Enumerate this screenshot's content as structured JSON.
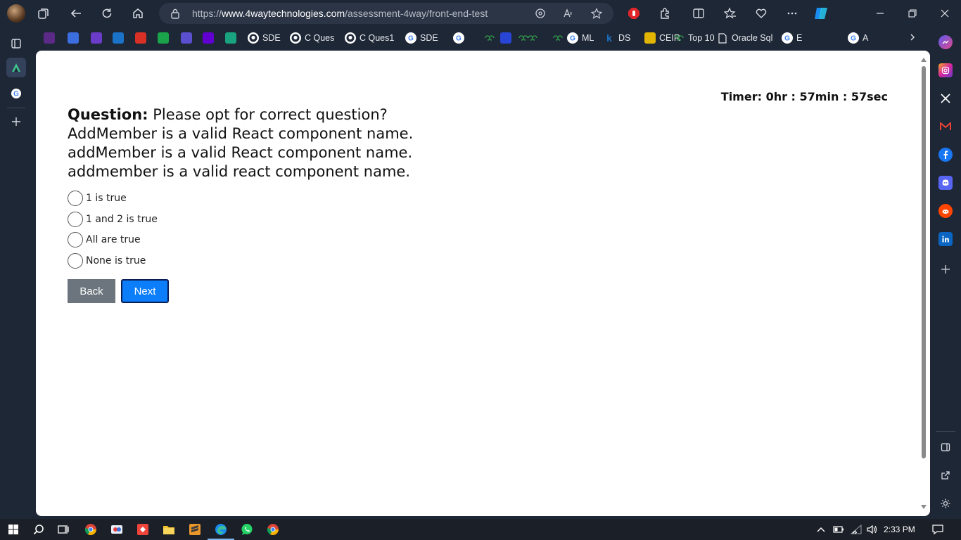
{
  "browser": {
    "url_prefix": "https://",
    "url_host": "www.4waytechnologies.com",
    "url_path": "/assessment-4way/front-end-test"
  },
  "bookmarks": [
    {
      "label": "",
      "icon": "purple-app-icon",
      "color": "#5b2a86"
    },
    {
      "label": "",
      "icon": "blue-flame-icon",
      "color": "#3b6fe0"
    },
    {
      "label": "",
      "icon": "to-icon",
      "color": "#6a3cc9"
    },
    {
      "label": "",
      "icon": "outlook-icon",
      "color": "#1a73c8"
    },
    {
      "label": "",
      "icon": "gmail-icon",
      "color": "#d93025"
    },
    {
      "label": "",
      "icon": "green-plus-icon",
      "color": "#1aa34a"
    },
    {
      "label": "",
      "icon": "swirl-icon",
      "color": "#5a4fcf"
    },
    {
      "label": "",
      "icon": "yahoo-icon",
      "color": "#6001d2"
    },
    {
      "label": "",
      "icon": "chatgpt-icon",
      "color": "#19a37f"
    },
    {
      "label": "SDE",
      "icon": "github-icon",
      "color": "#ffffff"
    },
    {
      "label": "C Ques",
      "icon": "github-icon",
      "color": "#ffffff"
    },
    {
      "label": "C Ques1",
      "icon": "github-icon",
      "color": "#ffffff"
    },
    {
      "label": "SDE",
      "icon": "google-icon",
      "color": "#ffffff"
    },
    {
      "label": "",
      "icon": "google-icon",
      "color": "#ffffff"
    },
    {
      "label": "",
      "icon": "gfg-icon",
      "color": "#2f8d46"
    },
    {
      "label": "",
      "icon": "blue-circle-icon",
      "color": "#2845d6"
    },
    {
      "label": "",
      "icon": "gfg-icon",
      "color": "#2f8d46"
    },
    {
      "label": "",
      "icon": "gfg-green-icon",
      "color": "#2f8d46"
    },
    {
      "label": "",
      "icon": "gfg-icon",
      "color": "#2f8d46"
    },
    {
      "label": "ML",
      "icon": "google-icon",
      "color": "#ffffff"
    },
    {
      "label": "DS",
      "icon": "k-icon",
      "color": "#1a73c8"
    },
    {
      "label": "CEIR",
      "icon": "ceir-icon",
      "color": "#e2b600"
    },
    {
      "label": "Top 10",
      "icon": "gfg-green-icon",
      "color": "#2f8d46"
    },
    {
      "label": "Oracle Sql",
      "icon": "page-icon",
      "color": "#ffffff"
    },
    {
      "label": "E",
      "icon": "g-icon",
      "color": "#ffffff"
    },
    {
      "label": "A",
      "icon": "google-icon",
      "color": "#ffffff"
    }
  ],
  "quiz": {
    "timer": "Timer: 0hr : 57min : 57sec",
    "question_label": "Question:",
    "question_lines": [
      "Please opt for correct question?",
      "AddMember is a valid React component name.",
      "addMember is a valid React component name.",
      "addmember is a valid react component name."
    ],
    "options": [
      "1 is true",
      "1 and 2 is true",
      "All are true",
      "None is true"
    ],
    "back_label": "Back",
    "next_label": "Next"
  },
  "taskbar": {
    "time": "2:33 PM"
  },
  "colors": {
    "chrome_bg": "#1e2736",
    "next_button": "#0d7ef9",
    "back_button": "#6c757d"
  }
}
